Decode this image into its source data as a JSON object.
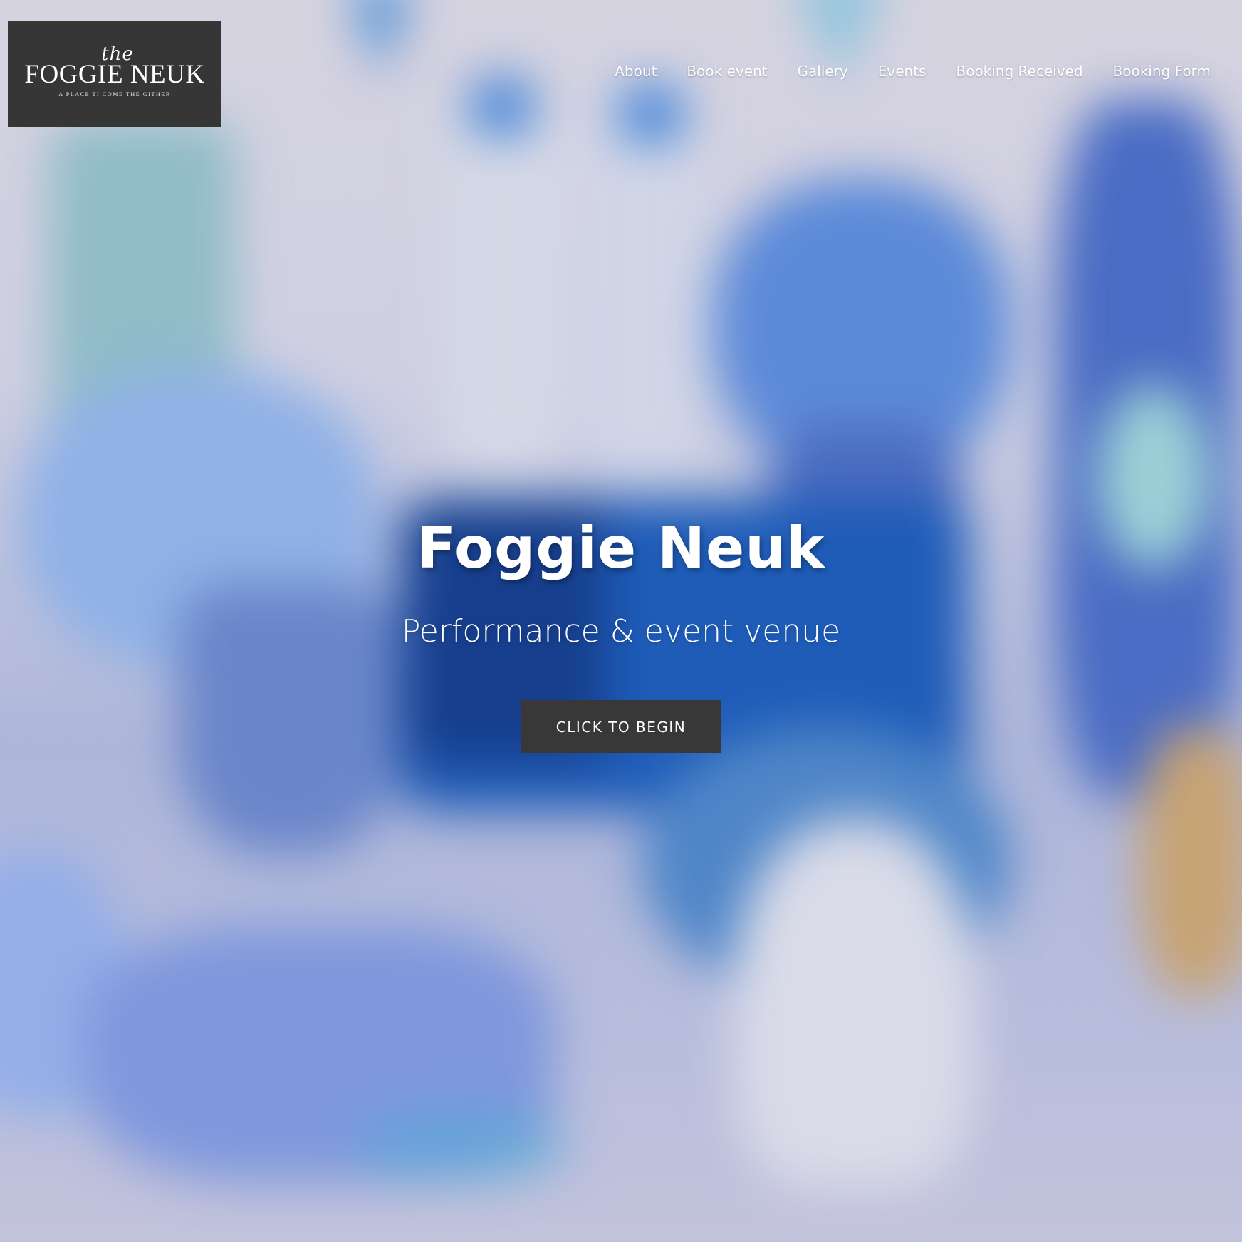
{
  "logo": {
    "the": "the",
    "name": "FOGGIE NEUK",
    "tagline": "A PLACE TI COME THE GITHER"
  },
  "nav": {
    "items": [
      {
        "label": "About"
      },
      {
        "label": "Book event"
      },
      {
        "label": "Gallery"
      },
      {
        "label": "Events"
      },
      {
        "label": "Booking Received"
      },
      {
        "label": "Booking Form"
      }
    ]
  },
  "hero": {
    "title": "Foggie Neuk",
    "subtitle": "Performance & event venue",
    "button_label": "Click to begin"
  },
  "colors": {
    "logo_background": "#363636",
    "button_background": "#383838",
    "text": "#ffffff",
    "background_accent_blue": "#2f6fc8",
    "background_base": "#c7c9dd"
  }
}
